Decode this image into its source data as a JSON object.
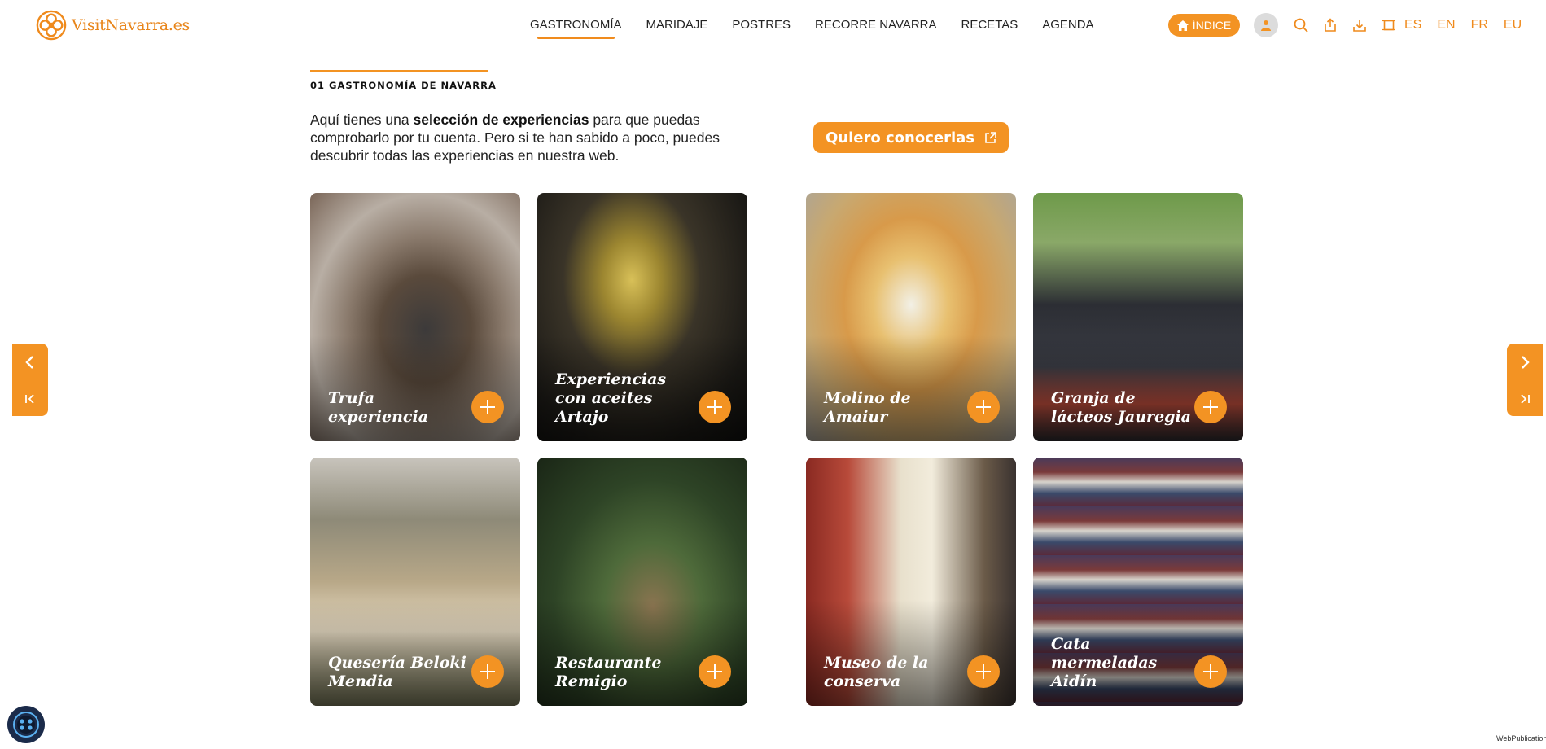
{
  "brand": {
    "name": "VisitNavarra.es",
    "color": "#f39323"
  },
  "nav": {
    "items": [
      {
        "label": "GASTRONOMÍA",
        "active": true
      },
      {
        "label": "MARIDAJE",
        "active": false
      },
      {
        "label": "POSTRES",
        "active": false
      },
      {
        "label": "RECORRE NAVARRA",
        "active": false
      },
      {
        "label": "RECETAS",
        "active": false
      },
      {
        "label": "AGENDA",
        "active": false
      }
    ]
  },
  "toolbar": {
    "index_label": "ÍNDICE",
    "icons": [
      "home-icon",
      "user-icon",
      "search-icon",
      "share-icon",
      "download-icon",
      "fullscreen-icon"
    ],
    "languages": [
      "ES",
      "EN",
      "FR",
      "EU"
    ]
  },
  "section": {
    "title": "01 GASTRONOMÍA DE NAVARRA",
    "intro_before": "Aquí tienes una ",
    "intro_bold": "selección de experiencias",
    "intro_after": " para que puedas comprobarlo por tu cuenta. Pero si te han sabido a poco, puedes descubrir todas las experiencias en nuestra web.",
    "cta_label": "Quiero conocerlas"
  },
  "cards": [
    {
      "title": "Trufa experiencia"
    },
    {
      "title": "Experiencias con aceites Artajo"
    },
    {
      "title": "Molino de Amaiur"
    },
    {
      "title": "Granja de lácteos Jauregia"
    },
    {
      "title": "Quesería Beloki Mendia"
    },
    {
      "title": "Restaurante Remigio"
    },
    {
      "title": "Museo de la conserva"
    },
    {
      "title": "Cata mermeladas Aidín"
    }
  ],
  "footer": {
    "credit": "WebPublication"
  }
}
